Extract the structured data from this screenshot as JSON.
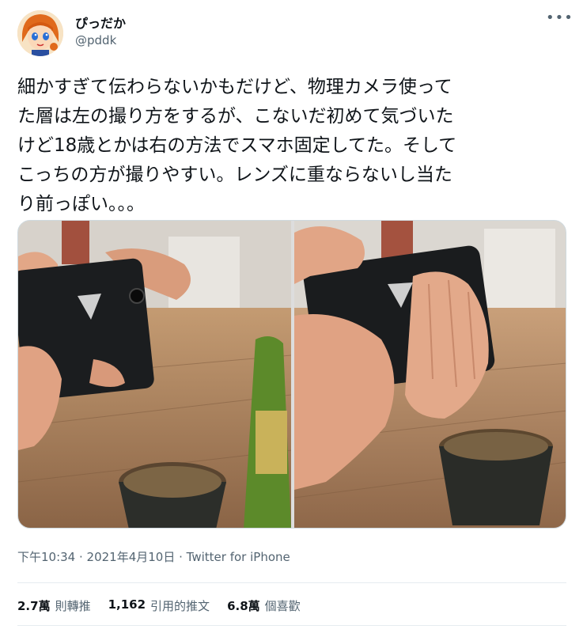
{
  "user": {
    "display_name": "ぴっだか",
    "handle": "@pddk",
    "avatar_icon": "anime-avatar-icon"
  },
  "tweet": {
    "text": "細かすぎて伝わらないかもだけど、物理カメラ使って\nた層は左の撮り方をするが、こないだ初めて気づいた\nけど18歳とかは右の方法でスマホ固定してた。そして\nこっちの方が撮りやすい。レンズに重ならないし当た\nり前っぽい。。。",
    "more_icon": "more-options-icon",
    "photos": [
      {
        "description_icon": "photo-phone-grip-left-icon"
      },
      {
        "description_icon": "photo-phone-grip-right-icon"
      }
    ]
  },
  "meta": {
    "time": "下午10:34",
    "date": "2021年4月10日",
    "source": "Twitter for iPhone",
    "separator": " · "
  },
  "stats": {
    "retweets": {
      "value": "2.7萬",
      "label": "則轉推"
    },
    "quotes": {
      "value": "1,162",
      "label": "引用的推文"
    },
    "likes": {
      "value": "6.8萬",
      "label": "個喜歡"
    }
  },
  "colors": {
    "text_primary": "#0f1419",
    "text_secondary": "#536471",
    "border": "#cfd9de"
  }
}
